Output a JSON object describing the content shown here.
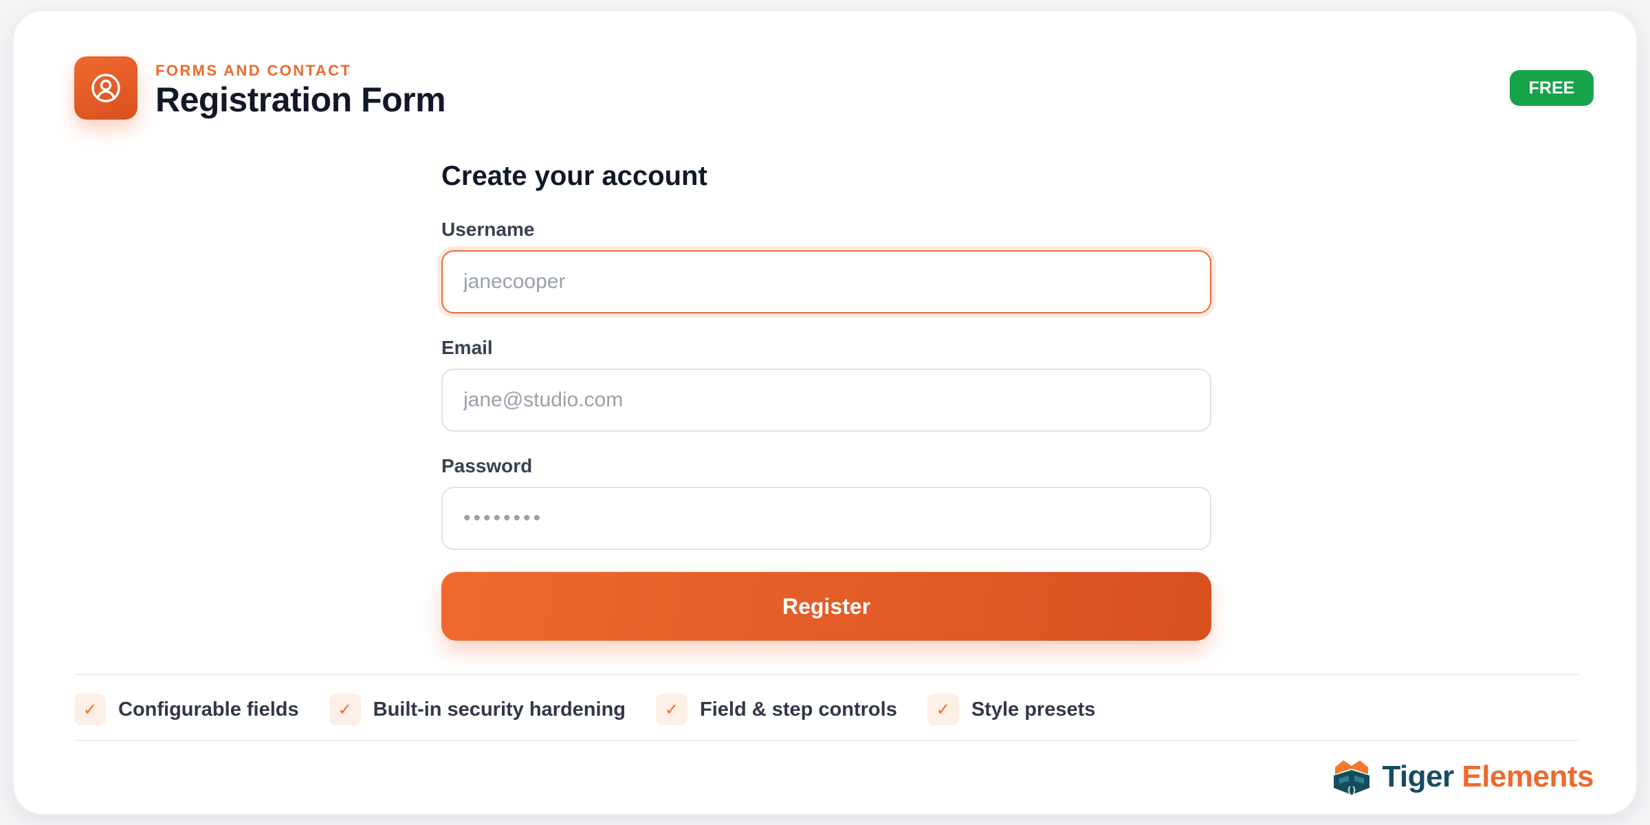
{
  "header": {
    "eyebrow": "FORMS AND CONTACT",
    "title": "Registration Form",
    "badge": "FREE",
    "icon": "user-circle-icon"
  },
  "form": {
    "heading": "Create your account",
    "fields": [
      {
        "label": "Username",
        "placeholder": "janecooper",
        "value": ""
      },
      {
        "label": "Email",
        "placeholder": "jane@studio.com",
        "value": ""
      },
      {
        "label": "Password",
        "placeholder": "••••••••",
        "value": ""
      }
    ],
    "submit_label": "Register"
  },
  "features": [
    {
      "label": "Configurable fields",
      "icon": "check-icon"
    },
    {
      "label": "Built-in security hardening",
      "icon": "check-icon"
    },
    {
      "label": "Field & step controls",
      "icon": "check-icon"
    },
    {
      "label": "Style presets",
      "icon": "check-icon"
    }
  ],
  "brand": {
    "name_part1": "Tiger",
    "name_part2": "Elements",
    "logo": "tiger-elements-logo-icon"
  },
  "colors": {
    "accent": "#ec6a2f",
    "badge": "#16a34a",
    "brand_dark": "#134e5e",
    "heading": "#111827"
  }
}
